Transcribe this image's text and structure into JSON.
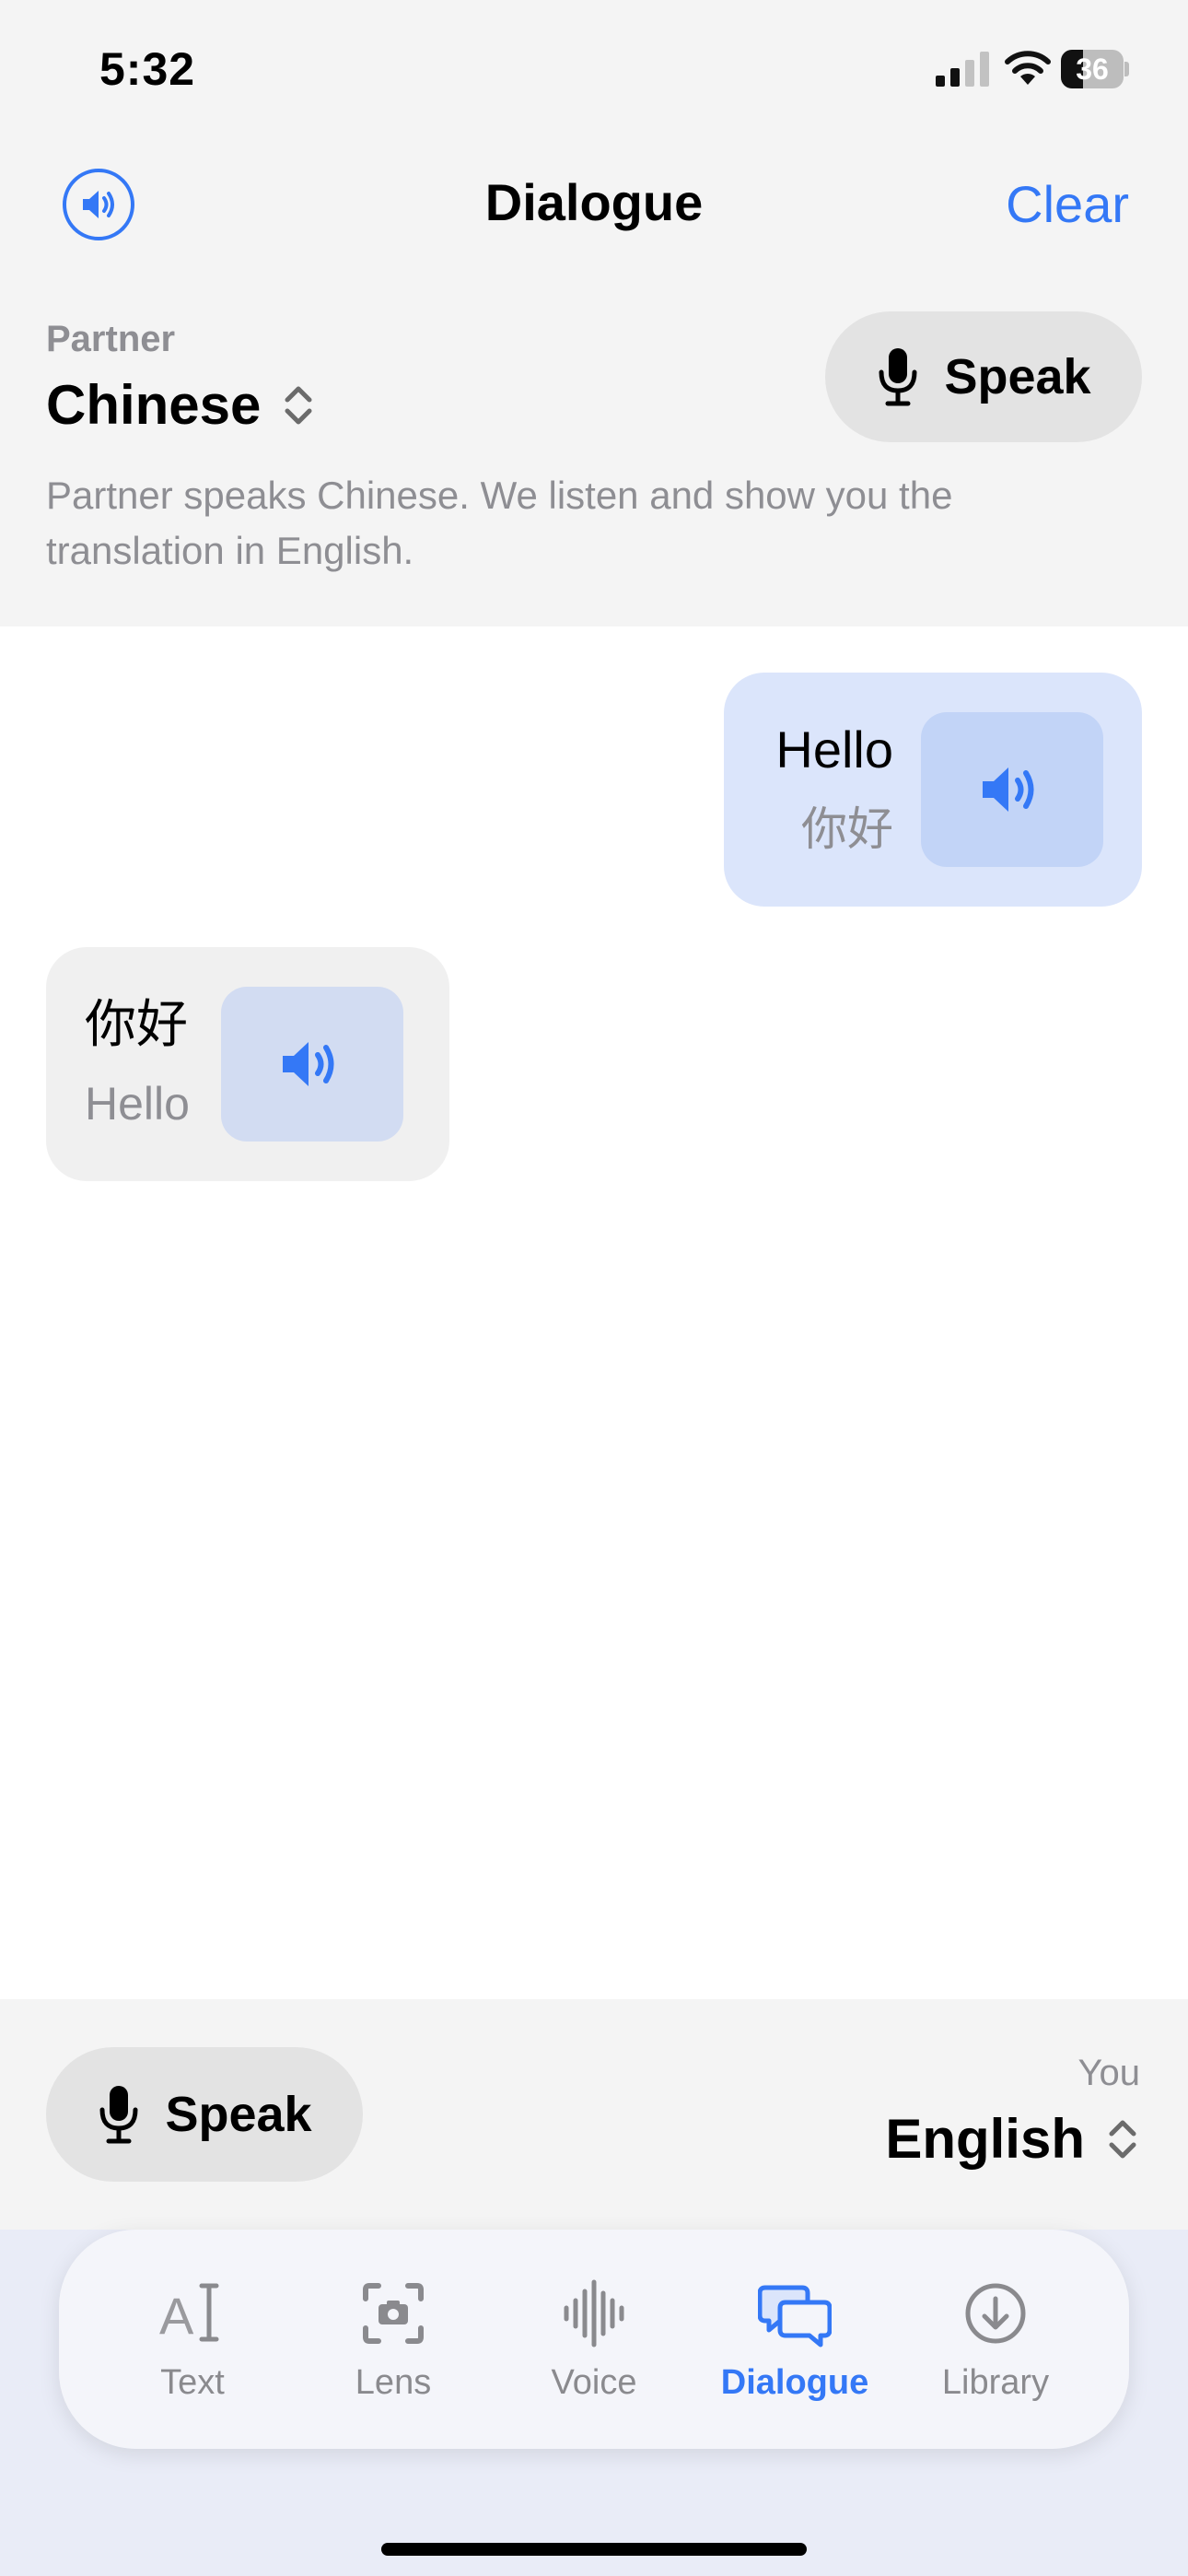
{
  "status_bar": {
    "time": "5:32",
    "battery": "36",
    "battery_level": 0.36
  },
  "header": {
    "title": "Dialogue",
    "clear_label": "Clear"
  },
  "partner": {
    "caption": "Partner",
    "language": "Chinese",
    "speak_label": "Speak",
    "description": "Partner speaks Chinese. We listen and show you the translation in English."
  },
  "messages": [
    {
      "side": "you",
      "primary": "Hello",
      "secondary": "你好"
    },
    {
      "side": "partner",
      "primary": "你好",
      "secondary": "Hello"
    }
  ],
  "you": {
    "caption": "You",
    "language": "English",
    "speak_label": "Speak"
  },
  "tabs": [
    {
      "label": "Text",
      "icon": "text-cursor-icon",
      "active": false
    },
    {
      "label": "Lens",
      "icon": "camera-viewfinder-icon",
      "active": false
    },
    {
      "label": "Voice",
      "icon": "waveform-icon",
      "active": false
    },
    {
      "label": "Dialogue",
      "icon": "chat-bubbles-icon",
      "active": true
    },
    {
      "label": "Library",
      "icon": "download-circle-icon",
      "active": false
    }
  ],
  "colors": {
    "accent": "#3478f6",
    "secondary_text": "#8e8e93",
    "you_bubble": "#dbe5fb",
    "partner_bubble": "#f0f0f0"
  }
}
